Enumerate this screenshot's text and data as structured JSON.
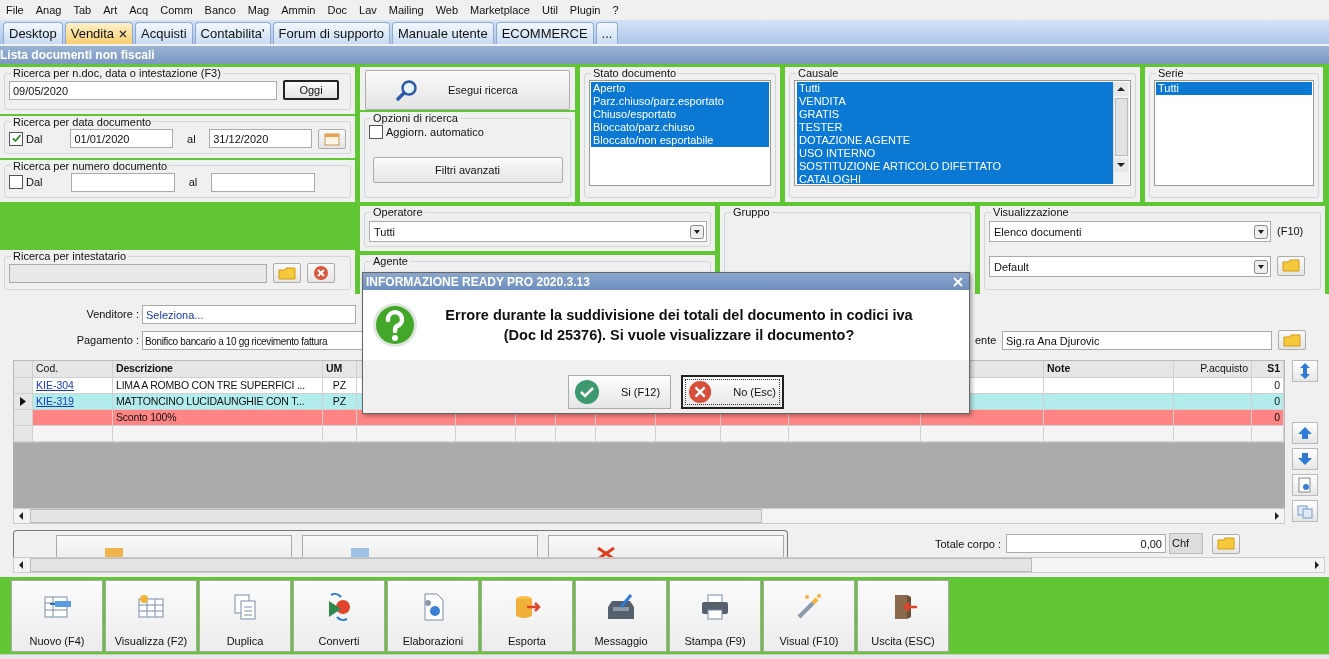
{
  "menu": [
    "File",
    "Anag",
    "Tab",
    "Art",
    "Acq",
    "Comm",
    "Banco",
    "Mag",
    "Ammin",
    "Doc",
    "Lav",
    "Mailing",
    "Web",
    "Marketplace",
    "Util",
    "Plugin",
    "?"
  ],
  "tabs": [
    {
      "label": "Desktop",
      "selected": false,
      "closable": false
    },
    {
      "label": "Vendita",
      "selected": true,
      "closable": true
    },
    {
      "label": "Acquisti",
      "selected": false,
      "closable": false
    },
    {
      "label": "Contabilita'",
      "selected": false,
      "closable": false
    },
    {
      "label": "Forum di supporto",
      "selected": false,
      "closable": false
    },
    {
      "label": "Manuale utente",
      "selected": false,
      "closable": false
    },
    {
      "label": "ECOMMERCE",
      "selected": false,
      "closable": false
    },
    {
      "label": "...",
      "selected": false,
      "closable": false
    }
  ],
  "window": {
    "title": "Lista documenti non fiscali"
  },
  "search_text": {
    "title": "Ricerca per n.doc, data o intestazione (F3)",
    "value": "09/05/2020",
    "button": "Oggi"
  },
  "date_search": {
    "title": "Ricerca per data documento",
    "checkbox": {
      "label": "Dal",
      "checked": true
    },
    "from": "01/01/2020",
    "to_label": "al",
    "to": "31/12/2020"
  },
  "number_search": {
    "title": "Ricerca per numero documento",
    "checkbox": {
      "label": "Dal",
      "checked": false
    },
    "to_label": "al"
  },
  "holder_search": {
    "title": "Ricerca per intestatario"
  },
  "search_button": "Esegui ricerca",
  "search_options": {
    "title": "Opzioni di ricerca",
    "auto_update": {
      "label": "Aggiorn. automatico",
      "checked": false
    },
    "advanced_button": "Filtri avanzati"
  },
  "status_list": {
    "title": "Stato documento",
    "items": [
      {
        "label": "Aperto",
        "selected": true
      },
      {
        "label": "Parz.chiuso/parz.esportato",
        "selected": true
      },
      {
        "label": "Chiuso/esportato",
        "selected": true
      },
      {
        "label": "Bloccato/parz.chiuso",
        "selected": true
      },
      {
        "label": "Bloccato/non esportabile",
        "selected": true
      }
    ]
  },
  "causale_list": {
    "title": "Causale",
    "items": [
      {
        "label": "Tutti",
        "selected": true
      },
      {
        "label": "VENDITA",
        "selected": true
      },
      {
        "label": "GRATIS",
        "selected": true
      },
      {
        "label": "TESTER",
        "selected": true
      },
      {
        "label": "DOTAZIONE AGENTE",
        "selected": true
      },
      {
        "label": "USO INTERNO",
        "selected": true
      },
      {
        "label": "SOSTITUZIONE ARTICOLO DIFETTATO",
        "selected": true
      },
      {
        "label": "CATALOGHI",
        "selected": true
      }
    ]
  },
  "serie_list": {
    "title": "Serie",
    "items": [
      {
        "label": "Tutti",
        "selected": true
      }
    ]
  },
  "operatore": {
    "title": "Operatore",
    "value": "Tutti"
  },
  "agente": {
    "title": "Agente"
  },
  "gruppo": {
    "title": "Gruppo"
  },
  "visualizzazione": {
    "title": "Visualizzazione",
    "view": "Elenco documenti",
    "shortcut": "(F10)",
    "layout": "Default"
  },
  "document": {
    "venditore_label": "Venditore :",
    "venditore": "Seleziona...",
    "pagamento_label": "Pagamento :",
    "pagamento": "Bonifico bancario a 10 gg ricevimento fattura",
    "cliente_label": "ente",
    "cliente": "Sig.ra Ana Djurovic"
  },
  "table": {
    "columns": [
      {
        "label": "Cod.",
        "bold": false
      },
      {
        "label": "Descrizione",
        "bold": true
      },
      {
        "label": "UM",
        "bold": true
      },
      {
        "label": "Note",
        "bold": true
      },
      {
        "label": "P.acquisto",
        "bold": false
      },
      {
        "label": "S1",
        "bold": true
      }
    ],
    "rows": [
      {
        "kind": "item",
        "code": "KIE-304",
        "description": "LIMA A ROMBO CON TRE SUPERFICI ...",
        "um": "PZ",
        "s1": "0",
        "selected": false
      },
      {
        "kind": "item",
        "code": "KIE-319",
        "description": "MATTONCINO LUCIDAUNGHIE CON T...",
        "um": "PZ",
        "s1": "0",
        "selected": true
      },
      {
        "kind": "discount",
        "description": "Sconto 100%",
        "s1": "0",
        "selected": false
      }
    ]
  },
  "totals": {
    "label": "Totale corpo :",
    "value": "0,00",
    "currency": "Chf"
  },
  "toolbar": [
    {
      "label": "Nuovo (F4)",
      "kind": "new"
    },
    {
      "label": "Visualizza (F2)",
      "kind": "view"
    },
    {
      "label": "Duplica",
      "kind": "copy"
    },
    {
      "label": "Converti",
      "kind": "convert"
    },
    {
      "label": "Elaborazioni",
      "kind": "process"
    },
    {
      "label": "Esporta",
      "kind": "export"
    },
    {
      "label": "Messaggio",
      "kind": "message"
    },
    {
      "label": "Stampa (F9)",
      "kind": "print"
    },
    {
      "label": "Visual (F10)",
      "kind": "visual"
    },
    {
      "label": "Uscita (ESC)",
      "kind": "exit"
    }
  ],
  "dialog": {
    "title": "INFORMAZIONE READY PRO 2020.3.13",
    "message": "Errore durante la suddivisione dei totali del documento in codici iva (Doc Id 25376). Si vuole visualizzare il documento?",
    "buttons": [
      {
        "label": "Si (F12)",
        "kind": "yes",
        "focused": false
      },
      {
        "label": "No (Esc)",
        "kind": "no",
        "focused": true
      }
    ]
  }
}
